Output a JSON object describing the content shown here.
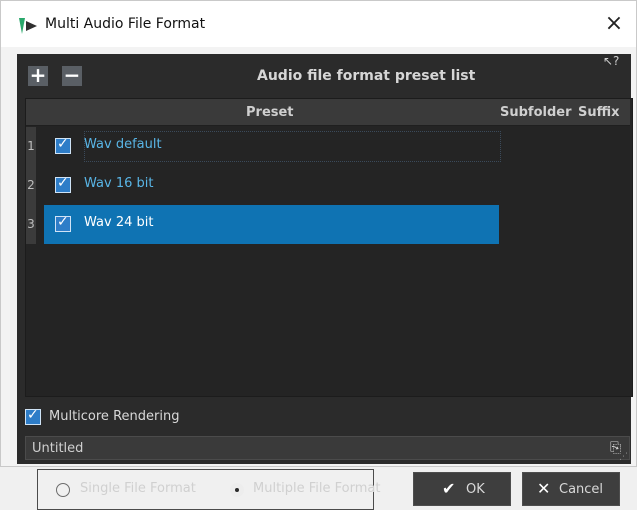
{
  "window": {
    "title": "Multi Audio File Format",
    "close_symbol": "×"
  },
  "toolbar": {
    "add_symbol": "+",
    "remove_symbol": "−",
    "heading": "Audio file format preset list",
    "help_icon": "pointer-help-icon"
  },
  "table": {
    "headers": {
      "preset": "Preset",
      "subfolder": "Subfolder",
      "suffix": "Suffix"
    },
    "rows": [
      {
        "index": "1",
        "label": "Wav default",
        "checked": true,
        "selected": false
      },
      {
        "index": "2",
        "label": "Wav 16 bit",
        "checked": true,
        "selected": false
      },
      {
        "index": "3",
        "label": "Wav 24 bit",
        "checked": true,
        "selected": true
      }
    ]
  },
  "options": {
    "multicore_label": "Multicore Rendering",
    "multicore_checked": true
  },
  "preset_name": {
    "value": "Untitled",
    "icon": "document-icon"
  },
  "format_mode": {
    "single_label": "Single File Format",
    "multiple_label": "Multiple File Format",
    "selected": "multiple"
  },
  "buttons": {
    "ok_label": "OK",
    "cancel_label": "Cancel"
  },
  "colors": {
    "accent": "#0f73b3",
    "checkbox": "#2e7dc8",
    "link_text": "#59b5e6",
    "panel_bg": "#2b2b2b"
  }
}
